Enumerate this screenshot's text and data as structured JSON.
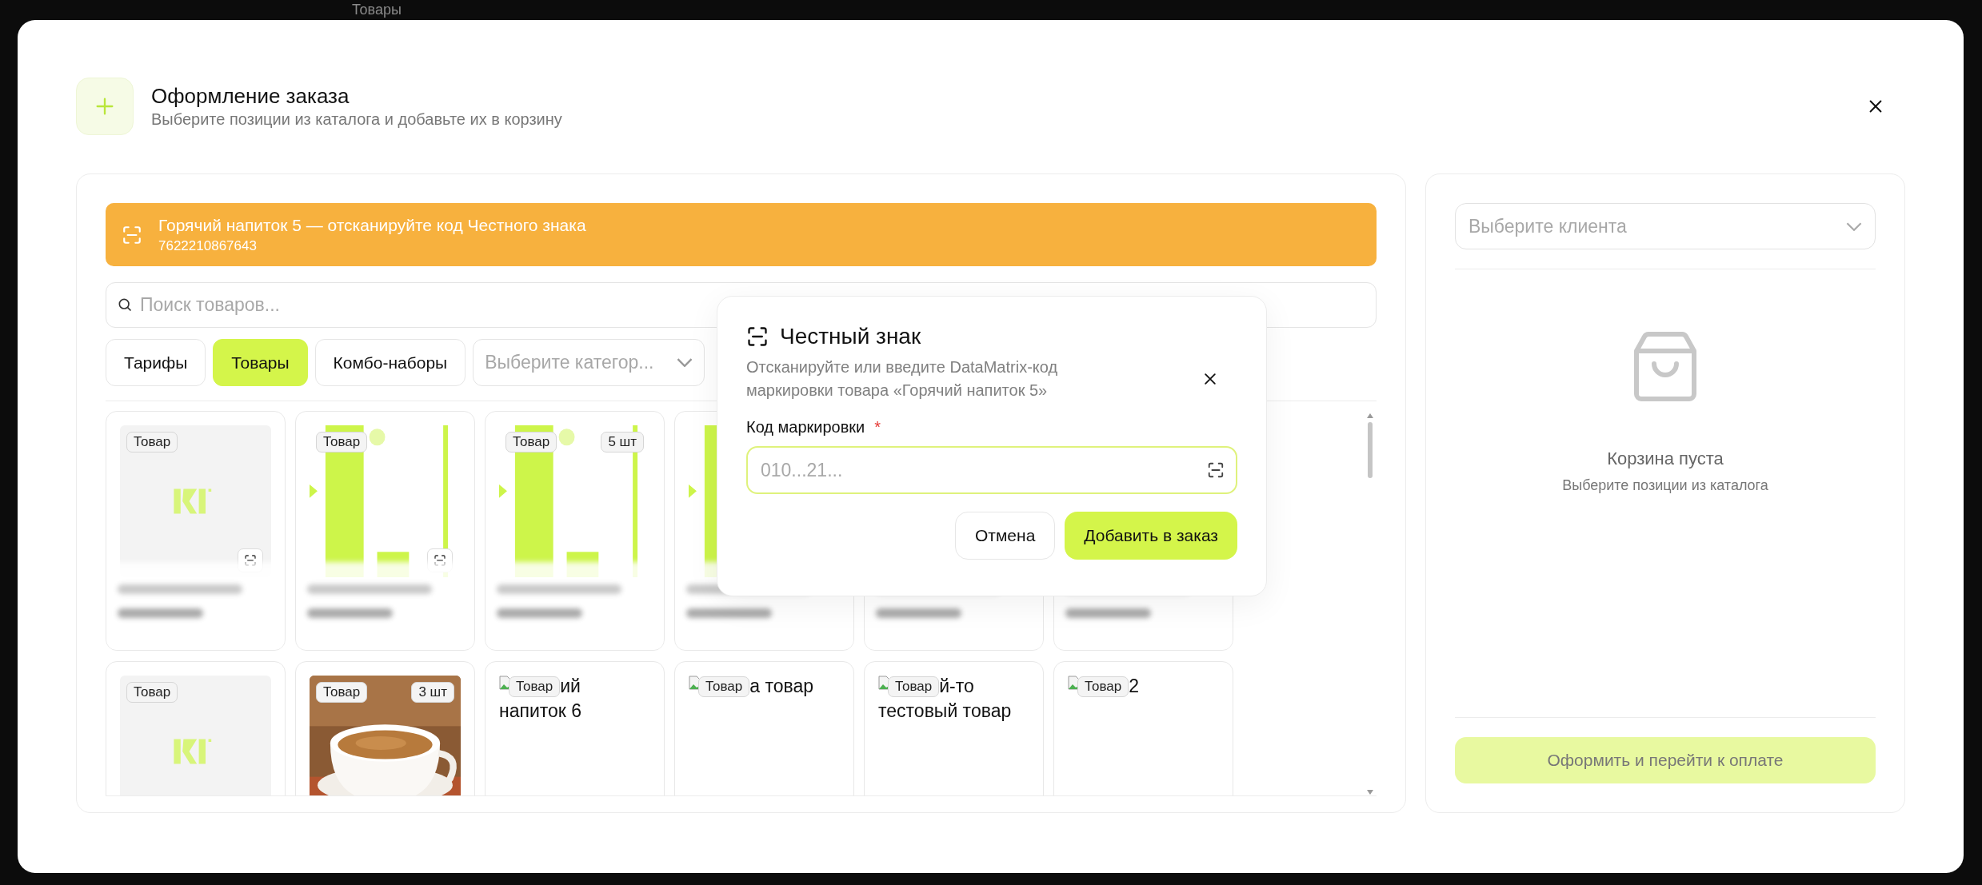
{
  "backdrop": {
    "title": "Товары"
  },
  "dialog": {
    "title": "Оформление заказа",
    "subtitle": "Выберите позиции из каталога и добавьте их в корзину"
  },
  "alert": {
    "title": "Горячий напиток 5 — отсканируйте код Честного знака",
    "code": "7622210867643"
  },
  "search": {
    "placeholder": "Поиск товаров..."
  },
  "tabs": [
    {
      "label": "Тарифы",
      "selected": false
    },
    {
      "label": "Товары",
      "selected": true
    },
    {
      "label": "Комбо-наборы",
      "selected": false
    }
  ],
  "category_select": {
    "placeholder": "Выберите категор..."
  },
  "products": [
    {
      "kind": "logo",
      "badges": [
        "Товар"
      ],
      "scan_button": true,
      "blurred": true
    },
    {
      "kind": "bars",
      "badges": [
        "Товар"
      ],
      "scan_button": true,
      "blurred": true
    },
    {
      "kind": "bars",
      "badges": [
        "Товар",
        "5 шт"
      ],
      "scan_button": false,
      "blurred": true
    },
    {
      "kind": "bars",
      "scan_button": false,
      "blurred": true
    },
    {
      "kind": "hidden",
      "scan_button": false,
      "blurred": true
    },
    {
      "kind": "hidden",
      "scan_button": false,
      "blurred": true
    },
    {
      "kind": "logo",
      "badges": [
        "Товар"
      ],
      "blurred": false
    },
    {
      "badges": [
        "Товар",
        "3 шт"
      ],
      "blurred": false
    },
    {
      "kind": "broken",
      "badges": [
        "Товар"
      ],
      "alt_text": [
        "ий",
        "напиток 6"
      ],
      "blurred": false
    },
    {
      "kind": "broken",
      "badges": [
        "Товар"
      ],
      "alt_text": [
        "а товар"
      ],
      "blurred": false
    },
    {
      "kind": "broken",
      "badges": [
        "Товар"
      ],
      "alt_text": [
        "й-то",
        "тестовый товар"
      ],
      "blurred": false
    },
    {
      "kind": "broken",
      "badges": [
        "Товар"
      ],
      "alt_text": [
        "2"
      ],
      "blurred": false
    }
  ],
  "scan_dialog": {
    "title": "Честный знак",
    "description": "Отсканируйте или введите DataMatrix-код маркировки товара «Горячий напиток 5»",
    "field_label": "Код маркировки",
    "required_mark": "*",
    "placeholder": "010...21...",
    "buttons": [
      {
        "label": "Отмена",
        "kind": "secondary"
      },
      {
        "label": "Добавить в заказ",
        "kind": "primary"
      }
    ]
  },
  "cart": {
    "client_placeholder": "Выберите клиента",
    "empty_title": "Корзина пуста",
    "empty_subtitle": "Выберите позиции из каталога",
    "checkout": {
      "label": "Оформить и перейти к оплате",
      "disabled": true
    }
  }
}
